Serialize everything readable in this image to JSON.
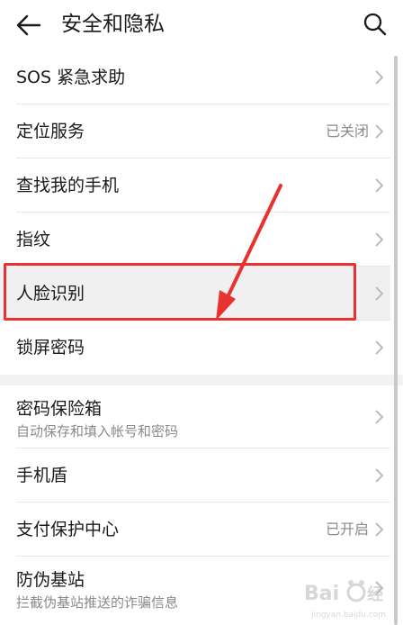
{
  "header": {
    "title": "安全和隐私",
    "back_icon": "arrow-left-icon",
    "search_icon": "search-icon"
  },
  "sections": [
    {
      "items": [
        {
          "label": "SOS 紧急求助",
          "value": ""
        },
        {
          "label": "定位服务",
          "value": "已关闭"
        },
        {
          "label": "查找我的手机",
          "value": ""
        },
        {
          "label": "指纹",
          "value": ""
        },
        {
          "label": "人脸识别",
          "value": "",
          "highlighted": true
        },
        {
          "label": "锁屏密码",
          "value": ""
        }
      ]
    },
    {
      "items": [
        {
          "label": "密码保险箱",
          "sub": "自动保存和填入帐号和密码",
          "value": ""
        },
        {
          "label": "手机盾",
          "value": ""
        },
        {
          "label": "支付保护中心",
          "value": "已开启"
        },
        {
          "label": "防伪基站",
          "sub": "拦截伪基站推送的诈骗信息",
          "value": ""
        }
      ]
    }
  ],
  "annotation": {
    "color": "#e8322f"
  },
  "watermark": {
    "text": "Bai du 经验",
    "url": "jingyan.baidu.com"
  }
}
